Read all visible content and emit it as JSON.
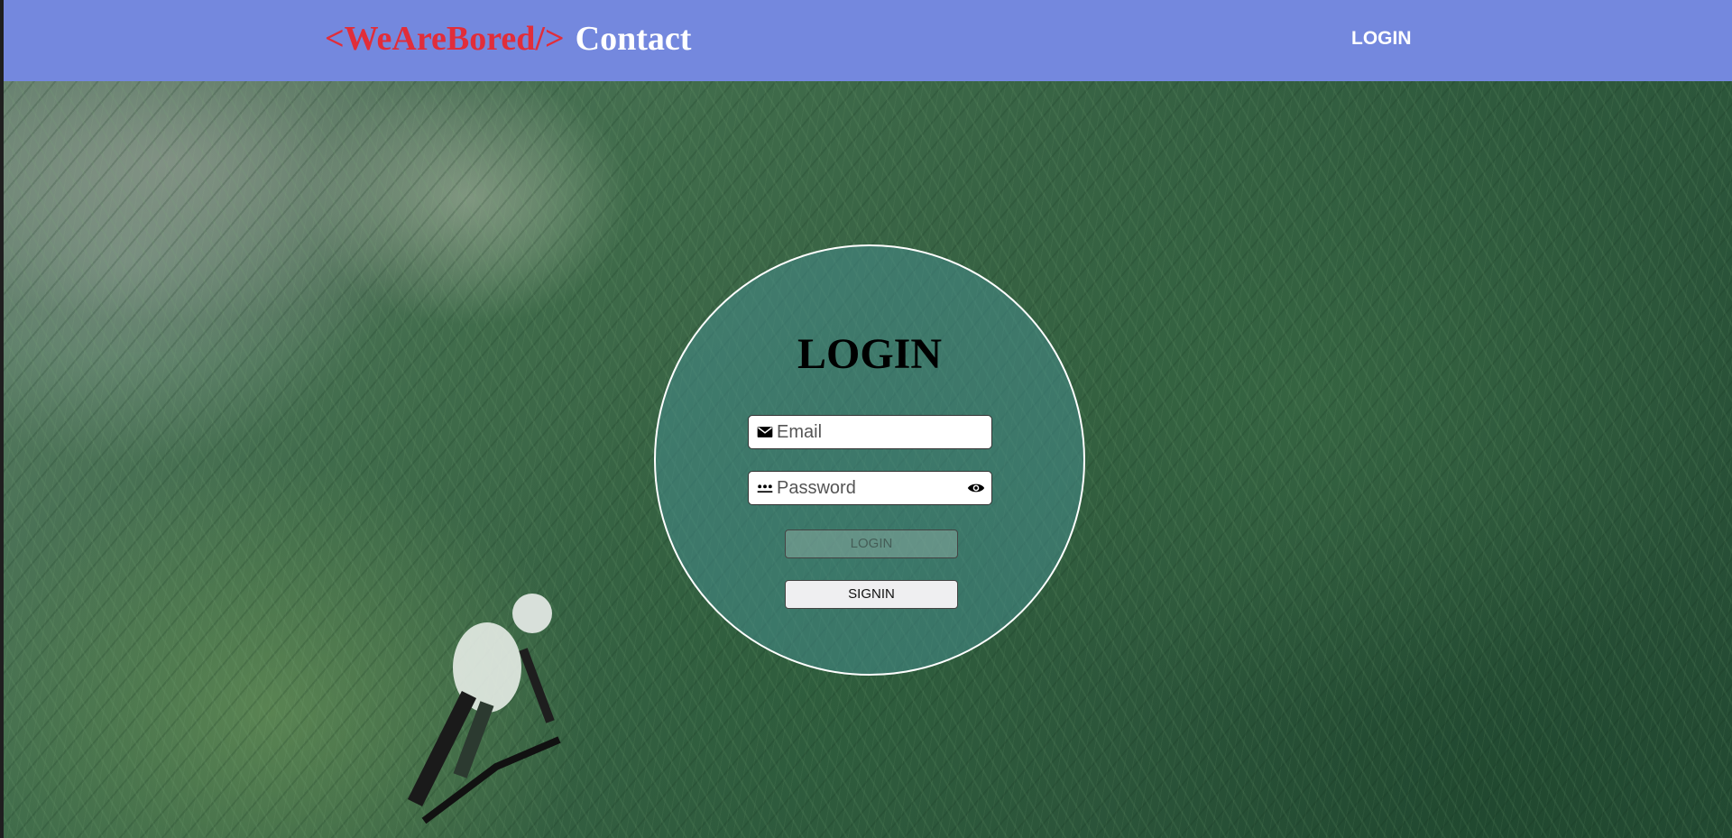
{
  "navbar": {
    "brand_tag": "<WeAreBored/>",
    "brand_contact": "Contact",
    "login_link": "LOGIN"
  },
  "login_card": {
    "title": "LOGIN",
    "email": {
      "placeholder": "Email",
      "value": ""
    },
    "password": {
      "placeholder": "Password",
      "value": ""
    },
    "login_button": "LOGIN",
    "signin_button": "SIGNIN"
  },
  "colors": {
    "navbar_bg": "#7488de",
    "brand_tag": "#e12d3a",
    "brand_contact": "#ffffff",
    "card_bg": "rgba(70,140,140,0.55)"
  },
  "icons": {
    "email": "mail-icon",
    "password": "password-dots-icon",
    "reveal": "eye-icon"
  }
}
